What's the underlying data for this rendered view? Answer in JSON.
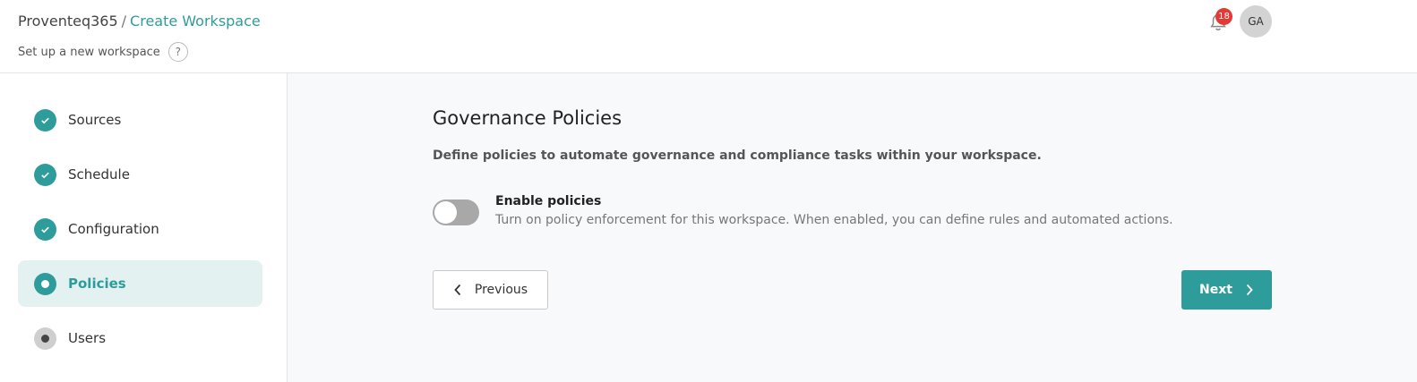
{
  "header": {
    "breadcrumb_root": "Proventeq365",
    "breadcrumb_sep": "/",
    "breadcrumb_current": "Create Workspace",
    "subtitle": "Set up a new workspace",
    "help_icon": "question-icon",
    "notifications_count": "18",
    "avatar_initials": "GA"
  },
  "steps": [
    {
      "label": "Sources",
      "state": "done"
    },
    {
      "label": "Schedule",
      "state": "done"
    },
    {
      "label": "Configuration",
      "state": "done"
    },
    {
      "label": "Policies",
      "state": "current"
    },
    {
      "label": "Users",
      "state": "pending"
    }
  ],
  "main": {
    "title": "Governance Policies",
    "description": "Define policies to automate governance and compliance tasks within your workspace.",
    "toggle_label": "Enable policies",
    "toggle_description": "Turn on policy enforcement for this workspace. When enabled, you can define rules and automated actions.",
    "toggle_on": false,
    "previous_label": "Previous",
    "next_label": "Next"
  },
  "colors": {
    "accent": "#2f9c9c",
    "badge": "#e53935",
    "active_step_bg": "#e3f1f1"
  }
}
